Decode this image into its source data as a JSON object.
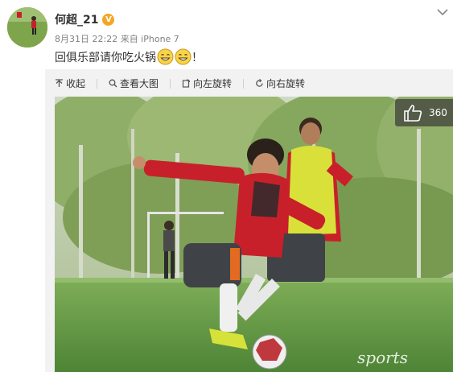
{
  "post": {
    "username": "何超_21",
    "verified_badge": "V",
    "meta": "8月31日 22:22 来自 iPhone 7",
    "text": "回俱乐部请你吃火锅",
    "text_suffix": "！",
    "emoji": "grin-emoji"
  },
  "toolbar": {
    "collapse": "收起",
    "view_large": "查看大图",
    "rotate_left": "向左旋转",
    "rotate_right": "向右旋转"
  },
  "photo": {
    "like_count": "360",
    "watermark": "sports"
  },
  "colors": {
    "badge": "#f5a623",
    "jersey_red": "#c8202a",
    "bib_yellow": "#d9e03a",
    "overlay": "#3c3c3c"
  }
}
